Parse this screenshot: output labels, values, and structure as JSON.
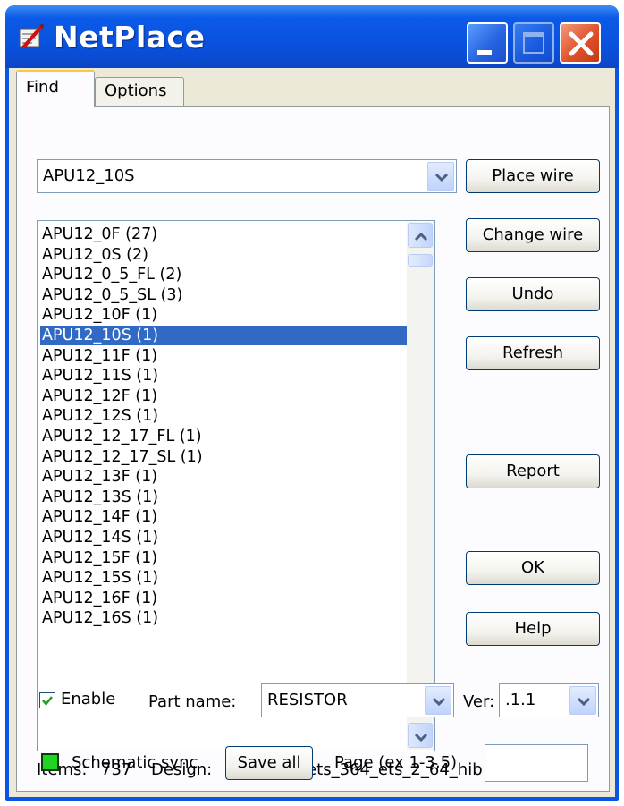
{
  "window": {
    "title": "NetPlace",
    "icon": "netplace-app-icon",
    "controls": {
      "minimize": "minimize-icon",
      "maximize": "maximize-icon",
      "close": "close-icon"
    }
  },
  "tabs": [
    {
      "label": "Find",
      "active": true
    },
    {
      "label": "Options",
      "active": false
    }
  ],
  "find": {
    "net_combo_value": "APU12_10S",
    "list_items": [
      "APU12_0F (27)",
      "APU12_0S (2)",
      "APU12_0_5_FL (2)",
      "APU12_0_5_SL (3)",
      "APU12_10F (1)",
      "APU12_10S (1)",
      "APU12_11F (1)",
      "APU12_11S (1)",
      "APU12_12F (1)",
      "APU12_12S (1)",
      "APU12_12_17_FL (1)",
      "APU12_12_17_SL (1)",
      "APU12_13F (1)",
      "APU12_13S (1)",
      "APU12_14F (1)",
      "APU12_14S (1)",
      "APU12_15F (1)",
      "APU12_15S (1)",
      "APU12_16F (1)",
      "APU12_16S (1)"
    ],
    "selected_index": 5,
    "buttons": {
      "place_wire": "Place wire",
      "change_wire": "Change wire",
      "undo": "Undo",
      "refresh": "Refresh",
      "report": "Report",
      "ok": "OK",
      "help": "Help"
    },
    "items_label": "Items:",
    "items_count": "737",
    "design_label": "Design:",
    "design_value": "cds_16_3_ets_364_ets_2_64_hib",
    "enable_label": "Enable",
    "enable_checked": true,
    "part_name_label": "Part name:",
    "part_name_value": "RESISTOR",
    "ver_label": "Ver:",
    "ver_value": ".1.1",
    "sync_label": "Schematic sync",
    "sync_color": "#22d422",
    "save_all_label": "Save all",
    "page_label": "Page (ex 1-3,5)",
    "page_value": ""
  },
  "colors": {
    "titlebar": "#0a55e4",
    "selection": "#316ac5",
    "dialog_bg": "#ece9d8"
  }
}
